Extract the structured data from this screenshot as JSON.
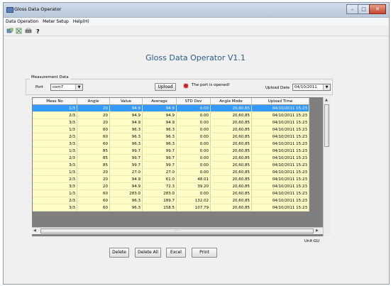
{
  "window": {
    "title": "Gloss Data Operator",
    "buttons": [
      "–",
      "□",
      "✕"
    ]
  },
  "menu": [
    "Data Operation",
    "Meter Setup",
    "Help(H)"
  ],
  "toolbar_icons": [
    "connect-icon",
    "export-icon",
    "print-icon",
    "help-icon"
  ],
  "app_title": "Gloss Data Operator V1.1",
  "measurement": {
    "group_label": "Measurement Data",
    "port_label": "Port",
    "port_value": "com7",
    "upload_button": "Upload",
    "status_text": "The  port is opened!",
    "upload_date_label": "Upload Date",
    "upload_date_value": "04/10/2011"
  },
  "table": {
    "columns": [
      "Meas No",
      "Angle",
      "Value",
      "Average",
      "STD Dev",
      "Angle Mode",
      "Upload Time"
    ],
    "rows": [
      [
        "1/3",
        "20",
        "94.9",
        "94.9",
        "0.00",
        "20,60,85",
        "04/10/2011 15:23"
      ],
      [
        "2/3",
        "20",
        "94.9",
        "94.9",
        "0.00",
        "20,60,85",
        "04/10/2011 15:23"
      ],
      [
        "3/3",
        "20",
        "94.9",
        "94.9",
        "0.00",
        "20,60,85",
        "04/10/2011 15:23"
      ],
      [
        "1/3",
        "60",
        "96.3",
        "96.3",
        "0.00",
        "20,60,85",
        "04/10/2011 15:23"
      ],
      [
        "2/3",
        "60",
        "96.3",
        "96.3",
        "0.00",
        "20,60,85",
        "04/10/2011 15:23"
      ],
      [
        "3/3",
        "60",
        "96.3",
        "96.3",
        "0.00",
        "20,60,85",
        "04/10/2011 15:23"
      ],
      [
        "1/3",
        "85",
        "99.7",
        "99.7",
        "0.00",
        "20,60,85",
        "04/10/2011 15:23"
      ],
      [
        "2/3",
        "85",
        "99.7",
        "99.7",
        "0.00",
        "20,60,85",
        "04/10/2011 15:23"
      ],
      [
        "3/3",
        "85",
        "99.7",
        "99.7",
        "0.00",
        "20,60,85",
        "04/10/2011 15:23"
      ],
      [
        "1/3",
        "20",
        "27.0",
        "27.0",
        "0.00",
        "20,60,85",
        "04/10/2011 15:23"
      ],
      [
        "2/3",
        "20",
        "94.9",
        "61.0",
        "48.01",
        "20,60,85",
        "04/10/2011 15:23"
      ],
      [
        "3/3",
        "20",
        "94.9",
        "72.3",
        "39.20",
        "20,60,85",
        "04/10/2011 15:23"
      ],
      [
        "1/3",
        "60",
        "283.0",
        "283.0",
        "0.00",
        "20,60,85",
        "04/10/2011 15:23"
      ],
      [
        "2/3",
        "60",
        "96.3",
        "189.7",
        "132.02",
        "20,60,85",
        "04/10/2011 15:23"
      ],
      [
        "3/3",
        "60",
        "96.3",
        "158.5",
        "107.79",
        "20,60,85",
        "04/10/2011 15:23"
      ]
    ],
    "selected_row": 0
  },
  "unit_text": "Unit:GU",
  "actions": {
    "delete": "Delete",
    "delete_all": "Delete All",
    "excel": "Excel",
    "print": "Print"
  }
}
